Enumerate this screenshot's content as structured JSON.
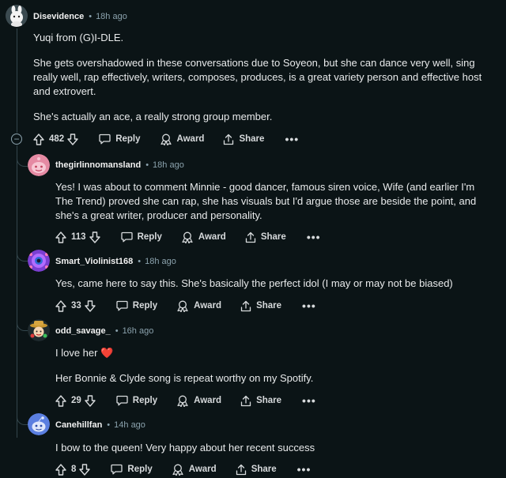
{
  "comments": [
    {
      "username": "Disevidence",
      "time": "18h ago",
      "avatar": "white-bunny-avatar",
      "paragraphs": [
        "Yuqi from (G)I-DLE.",
        "She gets overshadowed in these conversations due to Soyeon, but she can dance very well, sing really well, rap effectively, writers, composes, produces, is a great variety person and effective host and extrovert.",
        "She's actually an ace, a really strong group member."
      ],
      "votes": "482",
      "reply": "Reply",
      "award": "Award",
      "share": "Share",
      "more": "•••"
    },
    {
      "username": "thegirlinnomansland",
      "time": "18h ago",
      "avatar": "pink-snoo-avatar",
      "paragraphs": [
        "Yes! I was about to comment Minnie - good dancer, famous siren voice, Wife (and earlier I'm The Trend) proved she can rap, she has visuals but I'd argue those are beside the point, and she's a great writer, producer and personality."
      ],
      "votes": "113",
      "reply": "Reply",
      "award": "Award",
      "share": "Share",
      "more": "•••"
    },
    {
      "username": "Smart_Violinist168",
      "time": "18h ago",
      "avatar": "purple-robot-avatar",
      "paragraphs": [
        "Yes, came here to say this. She's basically the perfect idol (I may or may not be biased)"
      ],
      "votes": "33",
      "reply": "Reply",
      "award": "Award",
      "share": "Share",
      "more": "•••"
    },
    {
      "username": "odd_savage_",
      "time": "16h ago",
      "avatar": "cartoon-cowboy-avatar",
      "paragraphs": [
        "I love her",
        "Her Bonnie & Clyde song is repeat worthy on my Spotify."
      ],
      "votes": "29",
      "reply": "Reply",
      "award": "Award",
      "share": "Share",
      "more": "•••"
    },
    {
      "username": "Canehillfan",
      "time": "14h ago",
      "avatar": "blue-snoo-avatar",
      "paragraphs": [
        "I bow to the queen! Very happy about her recent success"
      ],
      "votes": "8",
      "reply": "Reply",
      "award": "Award",
      "share": "Share",
      "more": "•••"
    }
  ],
  "icons": {
    "upvote": "upvote-arrow-icon",
    "downvote": "downvote-arrow-icon",
    "reply": "speech-bubble-icon",
    "award": "award-ribbon-icon",
    "share": "share-upload-icon",
    "heart": "heart-emoji",
    "collapse": "collapse-minus-icon"
  },
  "colors": {
    "background": "#0b1416",
    "text": "#e8eaeb",
    "meta": "#8ba2ad",
    "heart": "#e0245e"
  }
}
